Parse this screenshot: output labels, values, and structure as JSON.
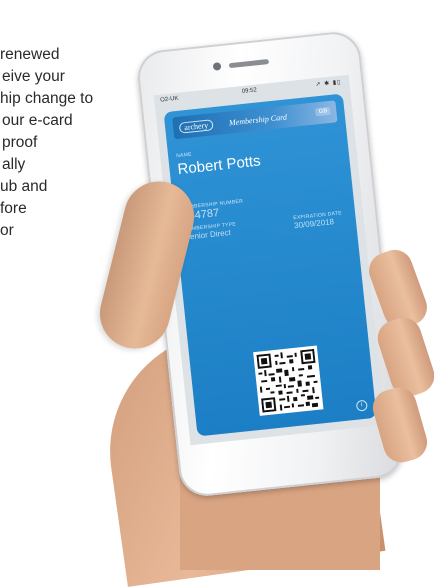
{
  "background_text": {
    "lines": [
      "renewed",
      "eive your",
      "hip change to",
      "our e-card",
      "proof",
      "ally",
      "ub and",
      "fore",
      "or"
    ]
  },
  "phone": {
    "status_bar": {
      "carrier": "O2-UK",
      "time": "09:52",
      "icons": "↗ ✱ ▮▯"
    },
    "card": {
      "logo": "archery",
      "title": "Membership Card",
      "tag": "GB",
      "name_label": "NAME",
      "name_value": "Robert Potts",
      "number_label": "MEMBERSHIP NUMBER",
      "number_value": "964787",
      "type_label": "MEMBERSHIP TYPE",
      "type_value": "Senior Direct",
      "expiry_label": "EXPIRATION DATE",
      "expiry_value": "30/09/2018",
      "info_icon": "i"
    }
  },
  "colors": {
    "card_blue": "#2f93d6",
    "text_white": "#ffffff"
  }
}
